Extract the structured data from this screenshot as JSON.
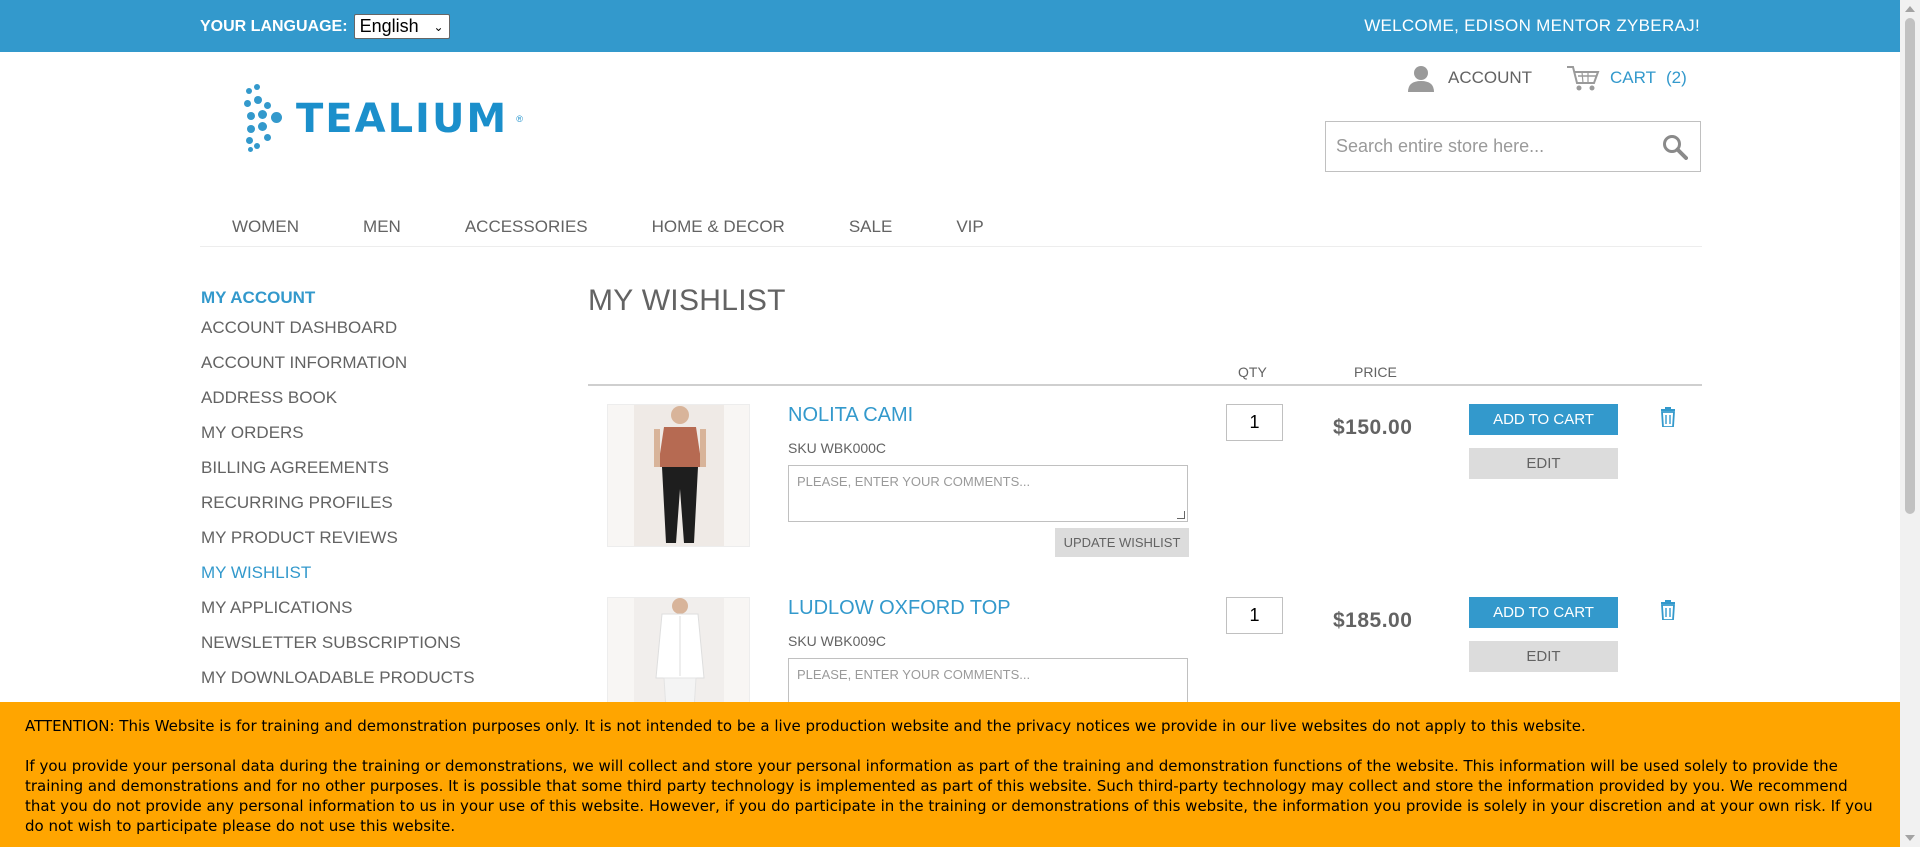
{
  "topbar": {
    "language_label": "YOUR LANGUAGE:",
    "language_value": "English",
    "welcome": "WELCOME, EDISON MENTOR ZYBERAJ!"
  },
  "header": {
    "logo_text": "TEALIUM",
    "account_label": "ACCOUNT",
    "cart_label": "CART",
    "cart_count": "(2)",
    "search_placeholder": "Search entire store here..."
  },
  "nav": {
    "items": [
      "WOMEN",
      "MEN",
      "ACCESSORIES",
      "HOME & DECOR",
      "SALE",
      "VIP"
    ]
  },
  "sidebar": {
    "title": "MY ACCOUNT",
    "items": [
      "ACCOUNT DASHBOARD",
      "ACCOUNT INFORMATION",
      "ADDRESS BOOK",
      "MY ORDERS",
      "BILLING AGREEMENTS",
      "RECURRING PROFILES",
      "MY PRODUCT REVIEWS",
      "MY WISHLIST",
      "MY APPLICATIONS",
      "NEWSLETTER SUBSCRIPTIONS",
      "MY DOWNLOADABLE PRODUCTS"
    ],
    "active_item": "MY WISHLIST"
  },
  "main": {
    "title": "MY WISHLIST",
    "col_qty": "QTY",
    "col_price": "PRICE",
    "items": [
      {
        "name": "NOLITA CAMI",
        "sku": "SKU WBK000C",
        "comment_placeholder": "PLEASE, ENTER YOUR COMMENTS...",
        "qty": "1",
        "price": "$150.00",
        "add_to_cart": "ADD TO CART",
        "edit": "EDIT",
        "update": "UPDATE WISHLIST",
        "garment_color": "#b66a52"
      },
      {
        "name": "LUDLOW OXFORD TOP",
        "sku": "SKU WBK009C",
        "comment_placeholder": "PLEASE, ENTER YOUR COMMENTS...",
        "qty": "1",
        "price": "$185.00",
        "add_to_cart": "ADD TO CART",
        "edit": "EDIT",
        "garment_color": "#ffffff"
      }
    ]
  },
  "notice": {
    "line1": "ATTENTION: This Website is for training and demonstration purposes only. It is not intended to be a live production website and the privacy notices we provide in our live websites do not apply to this website.",
    "line2": "If you provide your personal data during the training or demonstrations, we will collect and store your personal information as part of the training and demonstration functions of the website. This information will be used solely to provide the training and demonstrations and for no other purposes. It is possible that some third party technology is implemented as part of this website. Such third-party technology may collect and store the information provided by you. We recommend that you do not provide any personal information to us in your use of this website. However, if you do participate in the training or demonstrations of this website, the information you provide is solely in your discretion and at your own risk. If you do not wish to participate please do not use this website."
  },
  "colors": {
    "brand_blue": "#3399cc",
    "notice_orange": "#ffa500",
    "text_gray": "#636363"
  }
}
